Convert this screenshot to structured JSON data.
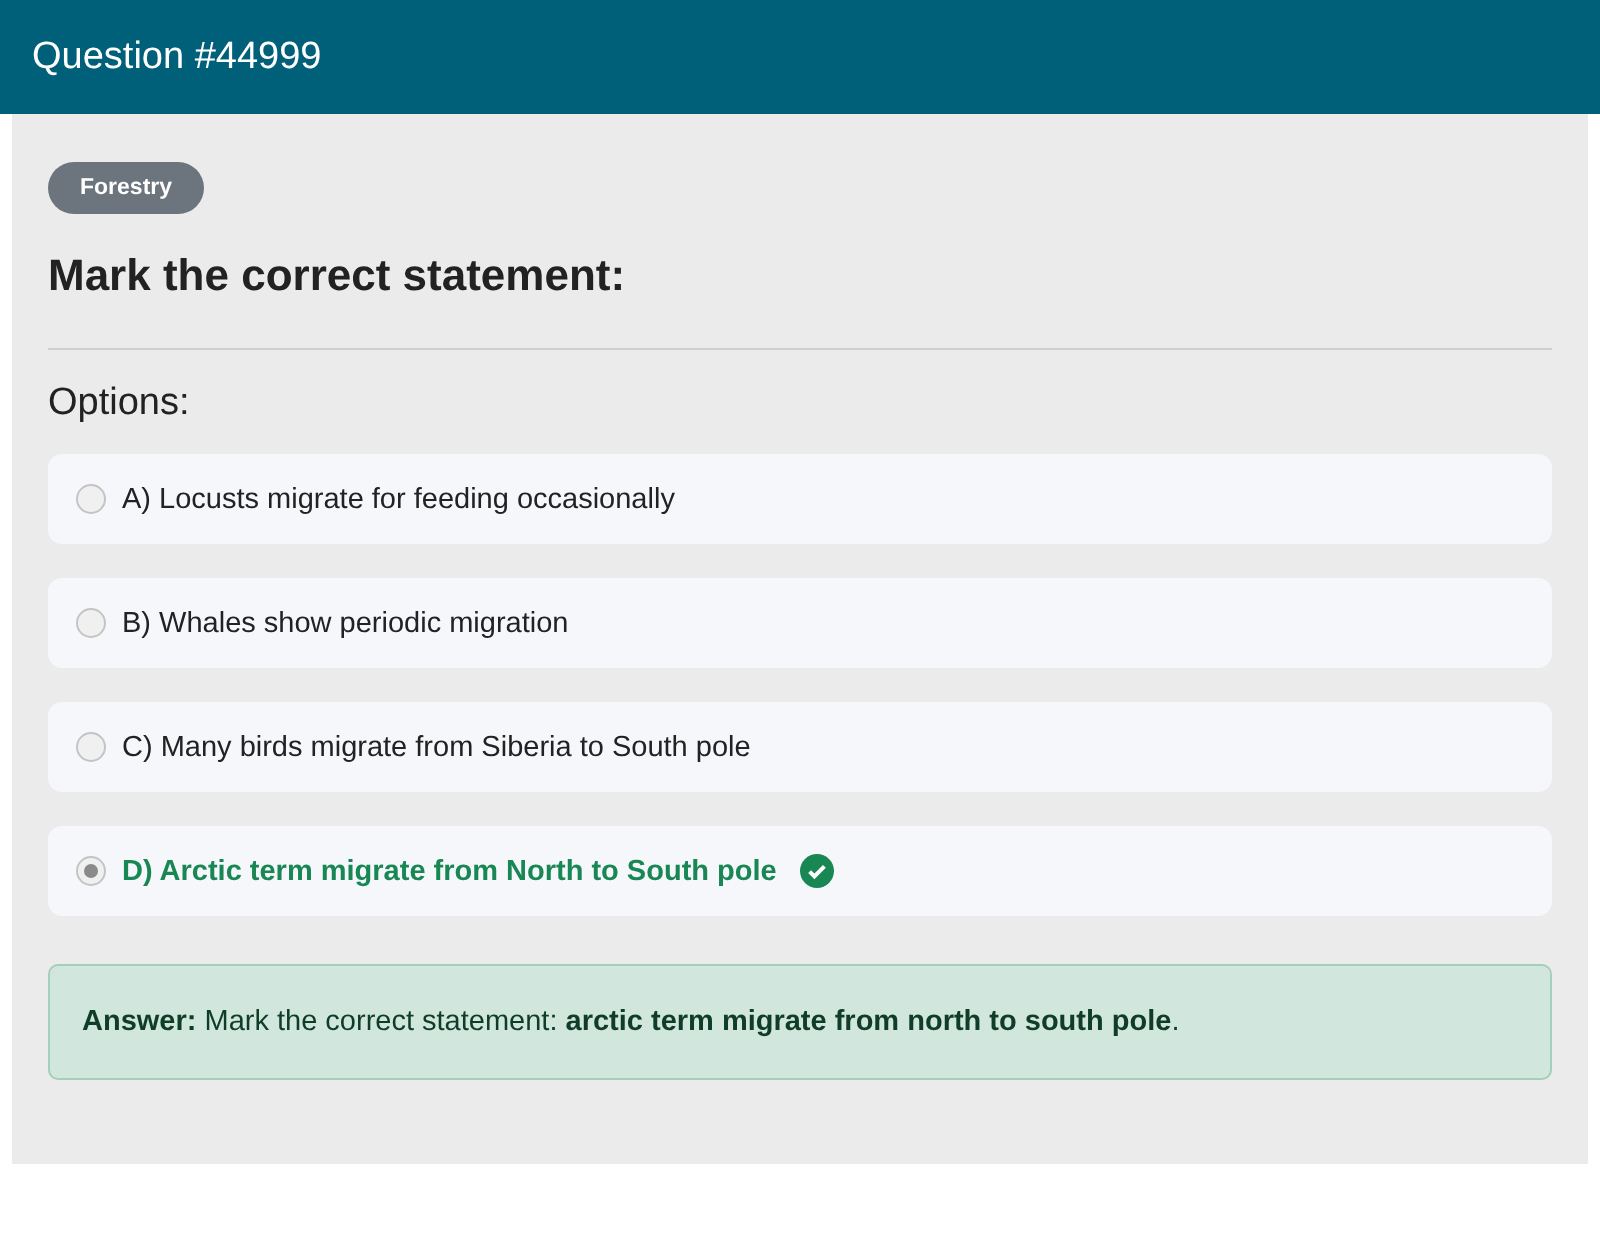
{
  "header": {
    "title": "Question #44999"
  },
  "category": "Forestry",
  "question": "Mark the correct statement:",
  "options_label": "Options:",
  "options": [
    {
      "text": "A) Locusts migrate for feeding occasionally",
      "selected": false,
      "correct": false
    },
    {
      "text": "B) Whales show periodic migration",
      "selected": false,
      "correct": false
    },
    {
      "text": "C) Many birds migrate from Siberia to South pole",
      "selected": false,
      "correct": false
    },
    {
      "text": "D) Arctic term migrate from North to South pole",
      "selected": true,
      "correct": true
    }
  ],
  "answer": "**Answer:** Mark the correct statement: **arctic term migrate from north to south pole**."
}
